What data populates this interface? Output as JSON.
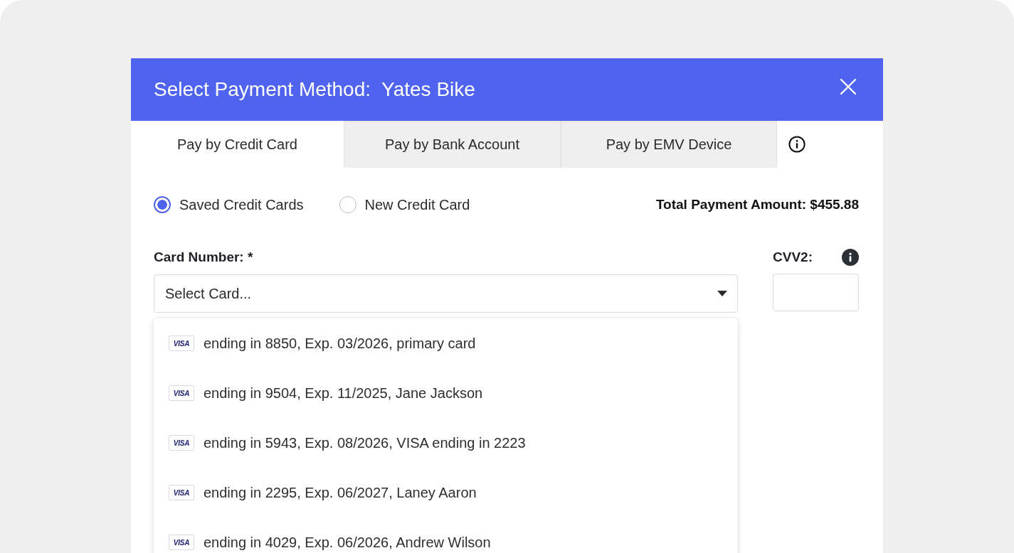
{
  "dialog": {
    "title": "Select Payment Method:  Yates Bike",
    "tabs": [
      {
        "label": "Pay by Credit Card",
        "selected": true
      },
      {
        "label": "Pay by Bank Account",
        "selected": false
      },
      {
        "label": "Pay by EMV Device",
        "selected": false
      }
    ],
    "card_sources": [
      {
        "label": "Saved Credit Cards",
        "selected": true
      },
      {
        "label": "New Credit Card",
        "selected": false
      }
    ],
    "total_payment": "Total Payment Amount: $455.88",
    "card_number": {
      "label": "Card Number: *",
      "placeholder": "Select Card...",
      "expanded": true,
      "options": [
        {
          "brand": "VISA",
          "text": "ending in 8850, Exp. 03/2026, primary card",
          "selected": false
        },
        {
          "brand": "VISA",
          "text": "ending in 9504, Exp. 11/2025, Jane Jackson",
          "selected": false
        },
        {
          "brand": "VISA",
          "text": "ending in 5943, Exp. 08/2026, VISA ending in 2223",
          "selected": false
        },
        {
          "brand": "VISA",
          "text": "ending in 2295, Exp. 06/2027, Laney Aaron",
          "selected": false
        },
        {
          "brand": "VISA",
          "text": "ending in 4029, Exp. 06/2026, Andrew Wilson",
          "selected": false
        }
      ]
    },
    "cvv": {
      "label": "CVV2:"
    }
  }
}
